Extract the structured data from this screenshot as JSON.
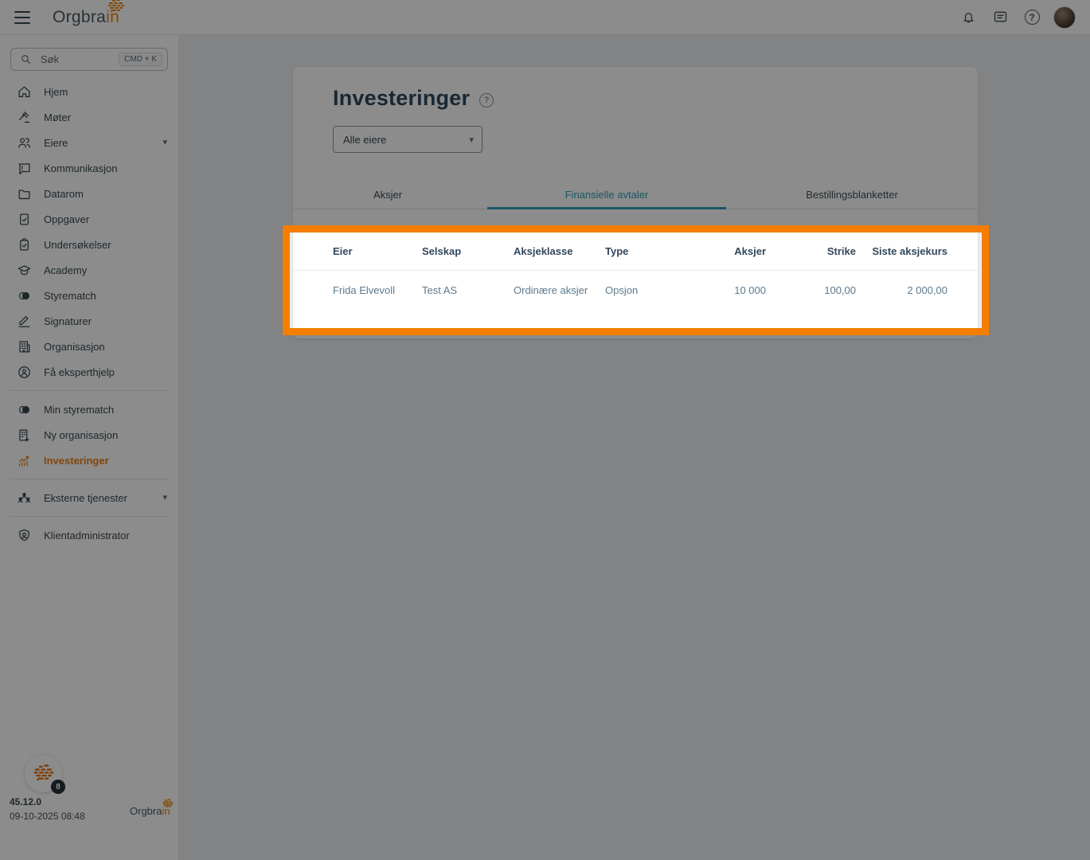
{
  "brand": {
    "prefix": "Orgbra",
    "suffix": "in"
  },
  "header": {
    "icons": [
      "menu-icon",
      "bell-icon",
      "message-icon",
      "help-icon",
      "avatar"
    ]
  },
  "sidebar": {
    "search": {
      "placeholder": "Søk",
      "shortcut": "CMD + K"
    },
    "items": [
      {
        "label": "Hjem",
        "icon": "home-icon"
      },
      {
        "label": "Møter",
        "icon": "gavel-icon"
      },
      {
        "label": "Eiere",
        "icon": "owners-icon",
        "expandable": true
      },
      {
        "label": "Kommunikasjon",
        "icon": "chat-alert-icon"
      },
      {
        "label": "Datarom",
        "icon": "folder-icon"
      },
      {
        "label": "Oppgaver",
        "icon": "task-check-icon"
      },
      {
        "label": "Undersøkelser",
        "icon": "clipboard-check-icon"
      },
      {
        "label": "Academy",
        "icon": "graduation-cap-icon"
      },
      {
        "label": "Styrematch",
        "icon": "venn-icon"
      },
      {
        "label": "Signaturer",
        "icon": "signature-icon"
      },
      {
        "label": "Organisasjon",
        "icon": "building-icon"
      },
      {
        "label": "Få eksperthjelp",
        "icon": "expert-help-icon"
      },
      {
        "label": "Min styrematch",
        "icon": "venn-icon"
      },
      {
        "label": "Ny organisasjon",
        "icon": "building-plus-icon"
      },
      {
        "label": "Investeringer",
        "icon": "investments-chart-icon",
        "active": true
      },
      {
        "label": "Eksterne tjenester",
        "icon": "group-icon",
        "expandable": true
      },
      {
        "label": "Klientadministrator",
        "icon": "shield-icon"
      }
    ]
  },
  "main": {
    "title": "Investeringer",
    "filter": {
      "value": "Alle eiere"
    },
    "tabs": [
      {
        "label": "Aksjer",
        "active": false
      },
      {
        "label": "Finansielle avtaler",
        "active": true
      },
      {
        "label": "Bestillingsblanketter",
        "active": false
      }
    ],
    "table": {
      "columns": [
        "Eier",
        "Selskap",
        "Aksjeklasse",
        "Type",
        "Aksjer",
        "Strike",
        "Siste aksjekurs"
      ],
      "rows": [
        [
          "Frida Elvevoll",
          "Test AS",
          "Ordinære aksjer",
          "Opsjon",
          "10 000",
          "100,00",
          "2 000,00"
        ]
      ]
    }
  },
  "footer": {
    "version": "45.12.0",
    "timestamp": "09-10-2025 08:48",
    "badge_count": "8"
  },
  "colors": {
    "accent_orange": "#F08100",
    "highlight_border": "#F57E00",
    "active_teal": "#2FA0B8",
    "heading_navy": "#2F4A5E"
  }
}
